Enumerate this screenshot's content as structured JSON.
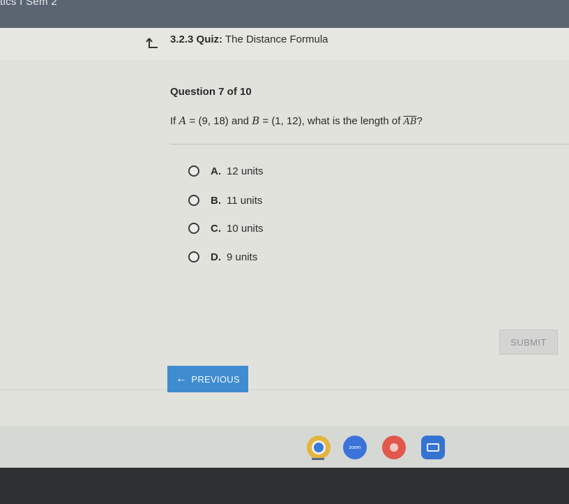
{
  "browser": {
    "tab_title_fragment": "tics I Sem 2"
  },
  "quiz_header": {
    "number": "3.2.3",
    "label": "Quiz:",
    "title": "The Distance Formula",
    "back_icon": "return-arrow-icon"
  },
  "question": {
    "heading": "Question 7 of 10",
    "prefix": "If",
    "var_a": "A",
    "eq_a": " = (9, 18) ",
    "and_word": "and",
    "var_b": "B",
    "eq_b": " = (1, 12)",
    "middle": ", what is the length of ",
    "segment": "AB",
    "suffix": "?"
  },
  "choices": [
    {
      "letter": "A.",
      "text": "12 units"
    },
    {
      "letter": "B.",
      "text": "11 units"
    },
    {
      "letter": "C.",
      "text": "10 units"
    },
    {
      "letter": "D.",
      "text": "9 units"
    }
  ],
  "actions": {
    "submit_label": "SUBMIT",
    "previous_label": "PREVIOUS",
    "previous_icon": "left-arrow-icon"
  },
  "shelf": {
    "apps": [
      "chrome-icon",
      "zoom-icon",
      "paint-icon",
      "slides-icon"
    ],
    "zoom_label": "zoom"
  },
  "colors": {
    "previous_button": "#3f8dd0",
    "submit_disabled": "#d4d5d2"
  }
}
